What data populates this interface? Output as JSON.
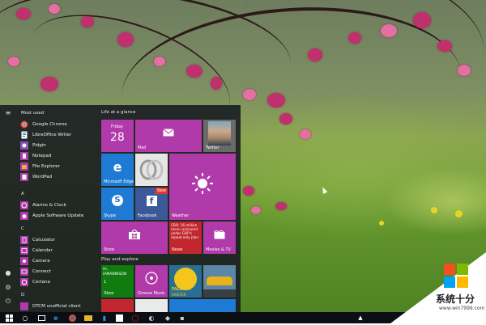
{
  "start_menu": {
    "most_used_header": "Most used",
    "most_used": [
      {
        "label": "Google Chrome",
        "icon": "chrome-icon",
        "color": "#e04a2f"
      },
      {
        "label": "LibreOffice Writer",
        "icon": "writer-icon",
        "color": "#2a74c4"
      },
      {
        "label": "Pidgin",
        "icon": "pidgin-icon",
        "color": "#8a4fc2"
      },
      {
        "label": "Notepad",
        "icon": "notepad-icon",
        "color": "#b03aa9"
      },
      {
        "label": "File Explorer",
        "icon": "folder-icon",
        "color": "#e2b530"
      },
      {
        "label": "WordPad",
        "icon": "wordpad-icon",
        "color": "#b03aa9"
      }
    ],
    "section_a": "A",
    "apps_a": [
      {
        "label": "Alarms & Clock",
        "icon": "alarm-icon",
        "color": "#b03aa9"
      },
      {
        "label": "Apple Software Update",
        "icon": "apple-update-icon",
        "color": "#b03aa9"
      }
    ],
    "section_c": "C",
    "apps_c": [
      {
        "label": "Calculator",
        "icon": "calculator-icon",
        "color": "#b03aa9"
      },
      {
        "label": "Calendar",
        "icon": "calendar-icon",
        "color": "#b03aa9"
      },
      {
        "label": "Camera",
        "icon": "camera-icon",
        "color": "#b03aa9"
      },
      {
        "label": "Connect",
        "icon": "connect-icon",
        "color": "#b03aa9"
      },
      {
        "label": "Cortana",
        "icon": "cortana-icon",
        "color": "#b03aa9"
      }
    ],
    "section_d": "D",
    "apps_d": [
      {
        "label": "DTCM unofficial client",
        "icon": "dtcm-icon",
        "color": "#b03aa9"
      }
    ]
  },
  "tiles": {
    "group1_header": "Life at a glance",
    "group2_header": "Play and explore",
    "calendar_day": "Friday",
    "calendar_date": "28",
    "mail": "Mail",
    "twitter": "Twitter",
    "edge": "Microsoft Edge",
    "skype": "Skype",
    "facebook": "Facebook",
    "facebook_badge": "New",
    "weather": "Weather",
    "store": "Store",
    "news_headline": "CBO: 16 million more uninsured under GOP's repeal-only plan",
    "news": "News",
    "movies": "Movies & TV",
    "xbox_text": "Hi, IAMANINSDN",
    "xbox_numbers": "1",
    "xbox": "Xbox",
    "groove": "Groove Music",
    "fallout_label": "FALLOUT",
    "fallout_sub": "SHELTER"
  },
  "watermark": {
    "text": "系统十分",
    "url": "www.win7999.com"
  },
  "colors": {
    "accent": "#b03aa9",
    "blue_tile": "#1f7ad3",
    "green_tile": "#107c10",
    "news_tile": "#c1272d"
  }
}
